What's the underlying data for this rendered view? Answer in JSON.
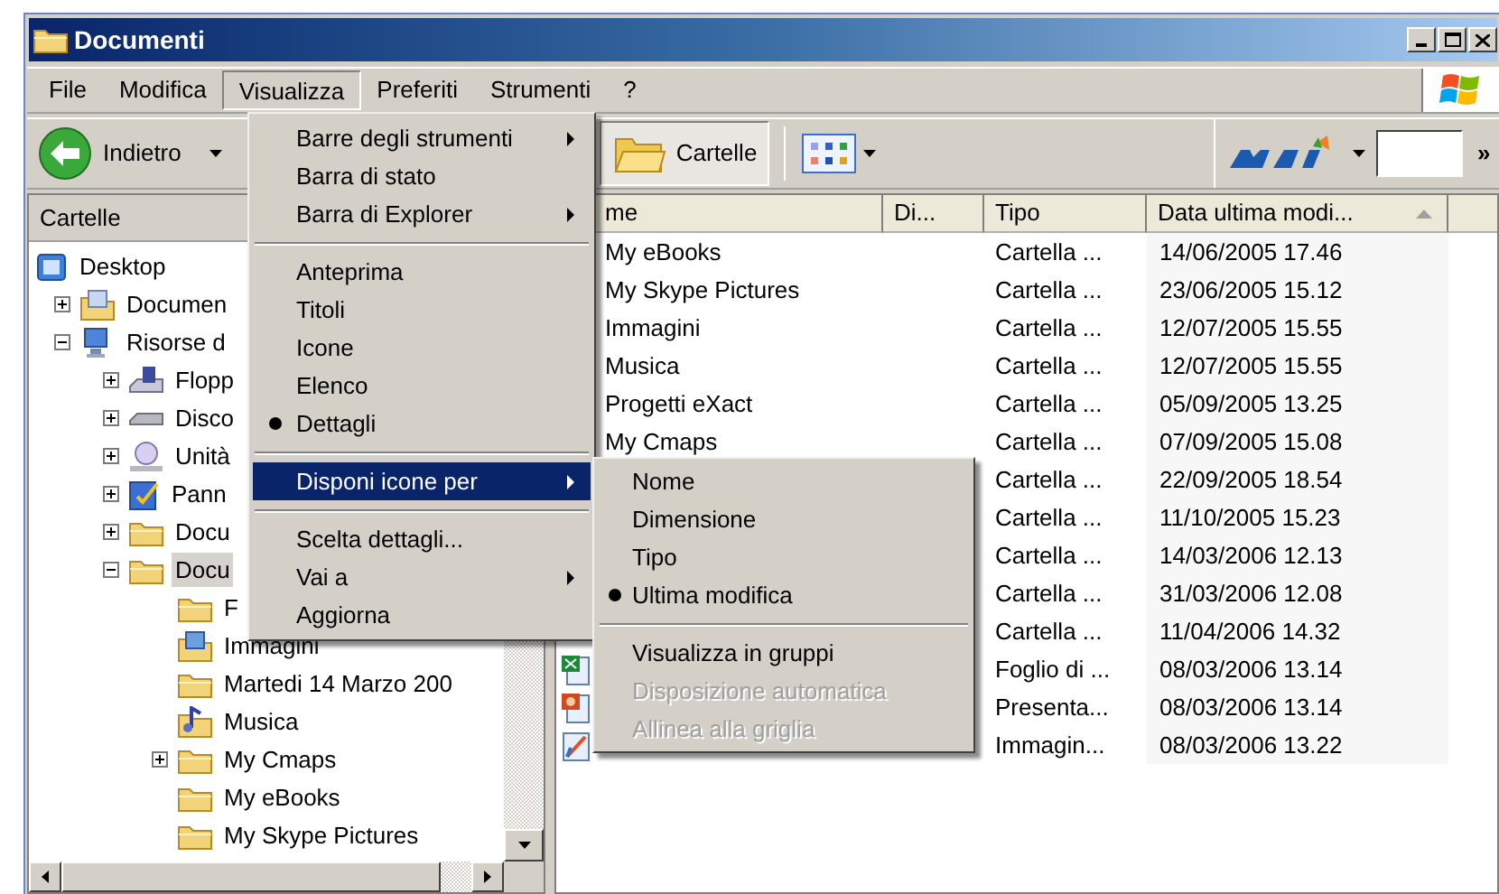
{
  "window": {
    "title": "Documenti"
  },
  "menu_bar": [
    {
      "label": "File",
      "selected": false
    },
    {
      "label": "Modifica",
      "selected": false
    },
    {
      "label": "Visualizza",
      "selected": true
    },
    {
      "label": "Preferiti",
      "selected": false
    },
    {
      "label": "Strumenti",
      "selected": false
    },
    {
      "label": "?",
      "selected": false
    }
  ],
  "toolbar": {
    "back": {
      "label": "Indietro"
    },
    "folders": {
      "label": "Cartelle",
      "pressed": true
    },
    "more": "»"
  },
  "folder_pane": {
    "title": "Cartelle",
    "tree": [
      {
        "label": "Desktop",
        "kind": "desktop",
        "has_toggle": false,
        "selected": false,
        "children": [
          {
            "label": "Documen",
            "kind": "documents",
            "has_toggle": true,
            "expanded": false,
            "selected": false
          },
          {
            "label": "Risorse d",
            "kind": "computer",
            "has_toggle": true,
            "expanded": true,
            "selected": false,
            "children": [
              {
                "label": "Flopp",
                "kind": "floppy",
                "has_toggle": true,
                "expanded": false,
                "selected": false
              },
              {
                "label": "Disco",
                "kind": "drive",
                "has_toggle": true,
                "expanded": false,
                "selected": false
              },
              {
                "label": "Unità",
                "kind": "cd",
                "has_toggle": true,
                "expanded": false,
                "selected": false
              },
              {
                "label": "Pann",
                "kind": "panel",
                "has_toggle": true,
                "expanded": false,
                "selected": false
              },
              {
                "label": "Docu",
                "kind": "folder",
                "has_toggle": true,
                "expanded": false,
                "selected": false
              },
              {
                "label": "Docu",
                "kind": "folder",
                "has_toggle": true,
                "expanded": true,
                "selected": true,
                "children": [
                  {
                    "label": "F",
                    "kind": "folder",
                    "has_toggle": false,
                    "selected": false
                  },
                  {
                    "label": "Immagini",
                    "kind": "pictures",
                    "has_toggle": false,
                    "selected": false
                  },
                  {
                    "label": "Martedi 14 Marzo 200",
                    "kind": "folder",
                    "has_toggle": false,
                    "selected": false
                  },
                  {
                    "label": "Musica",
                    "kind": "music",
                    "has_toggle": false,
                    "selected": false
                  },
                  {
                    "label": "My Cmaps",
                    "kind": "folder",
                    "has_toggle": true,
                    "expanded": false,
                    "selected": false
                  },
                  {
                    "label": "My eBooks",
                    "kind": "folder",
                    "has_toggle": false,
                    "selected": false
                  },
                  {
                    "label": "My Skype Pictures",
                    "kind": "folder",
                    "has_toggle": false,
                    "selected": false
                  }
                ]
              }
            ]
          }
        ]
      }
    ]
  },
  "file_list": {
    "columns": [
      {
        "label": "me",
        "sorted": false
      },
      {
        "label": "Di...",
        "sorted": false
      },
      {
        "label": "Tipo",
        "sorted": false
      },
      {
        "label": "Data ultima modi...",
        "sorted": true
      }
    ],
    "rows": [
      {
        "kind": "hidden",
        "name": "My eBooks",
        "type": "Cartella ...",
        "modified": "14/06/2005 17.46"
      },
      {
        "kind": "hidden",
        "name": "My Skype Pictures",
        "type": "Cartella ...",
        "modified": "23/06/2005 15.12"
      },
      {
        "kind": "hidden",
        "name": "Immagini",
        "type": "Cartella ...",
        "modified": "12/07/2005 15.55"
      },
      {
        "kind": "hidden",
        "name": "Musica",
        "type": "Cartella ...",
        "modified": "12/07/2005 15.55"
      },
      {
        "kind": "hidden",
        "name": "Progetti eXact",
        "type": "Cartella ...",
        "modified": "05/09/2005 13.25"
      },
      {
        "kind": "hidden",
        "name": "My Cmaps",
        "type": "Cartella ...",
        "modified": "07/09/2005 15.08"
      },
      {
        "kind": "hidden",
        "type": "Cartella ...",
        "modified": "22/09/2005 18.54"
      },
      {
        "kind": "hidden",
        "type": "Cartella ...",
        "modified": "11/10/2005 15.23"
      },
      {
        "kind": "hidden",
        "type": "Cartella ...",
        "modified": "14/03/2006 12.13"
      },
      {
        "kind": "hidden",
        "type": "Cartella ...",
        "modified": "31/03/2006 12.08"
      },
      {
        "kind": "hidden",
        "type": "Cartella ...",
        "modified": "11/04/2006 14.32"
      },
      {
        "kind": "spreadsheet",
        "type": "Foglio di ...",
        "modified": "08/03/2006 13.14"
      },
      {
        "kind": "presentation",
        "type": "Presenta...",
        "modified": "08/03/2006 13.14"
      },
      {
        "kind": "image",
        "type": "Immagin...",
        "modified": "08/03/2006 13.22"
      }
    ]
  },
  "view_menu": {
    "items": [
      {
        "kind": "item",
        "label": "Barre degli strumenti",
        "submenu": true,
        "checked": false,
        "selected": false
      },
      {
        "kind": "item",
        "label": "Barra di stato",
        "submenu": false,
        "checked": false,
        "selected": false
      },
      {
        "kind": "item",
        "label": "Barra di Explorer",
        "submenu": true,
        "checked": false,
        "selected": false
      },
      {
        "kind": "separator"
      },
      {
        "kind": "item",
        "label": "Anteprima",
        "submenu": false,
        "checked": false,
        "selected": false
      },
      {
        "kind": "item",
        "label": "Titoli",
        "submenu": false,
        "checked": false,
        "selected": false
      },
      {
        "kind": "item",
        "label": "Icone",
        "submenu": false,
        "checked": false,
        "selected": false
      },
      {
        "kind": "item",
        "label": "Elenco",
        "submenu": false,
        "checked": false,
        "selected": false
      },
      {
        "kind": "item",
        "label": "Dettagli",
        "submenu": false,
        "checked": true,
        "selected": false
      },
      {
        "kind": "separator"
      },
      {
        "kind": "item",
        "label": "Disponi icone per",
        "submenu": true,
        "checked": false,
        "selected": true
      },
      {
        "kind": "separator"
      },
      {
        "kind": "item",
        "label": "Scelta dettagli...",
        "submenu": false,
        "checked": false,
        "selected": false
      },
      {
        "kind": "item",
        "label": "Vai a",
        "submenu": true,
        "checked": false,
        "selected": false
      },
      {
        "kind": "item",
        "label": "Aggiorna",
        "submenu": false,
        "checked": false,
        "selected": false
      }
    ]
  },
  "arrange_submenu": {
    "items": [
      {
        "kind": "item",
        "label": "Nome",
        "checked": false,
        "disabled": false
      },
      {
        "kind": "item",
        "label": "Dimensione",
        "checked": false,
        "disabled": false
      },
      {
        "kind": "item",
        "label": "Tipo",
        "checked": false,
        "disabled": false
      },
      {
        "kind": "item",
        "label": "Ultima modifica",
        "checked": true,
        "disabled": false
      },
      {
        "kind": "separator"
      },
      {
        "kind": "item",
        "label": "Visualizza in gruppi",
        "checked": false,
        "disabled": false
      },
      {
        "kind": "item",
        "label": "Disposizione automatica",
        "checked": false,
        "disabled": true
      },
      {
        "kind": "item",
        "label": "Allinea alla griglia",
        "checked": false,
        "disabled": true
      }
    ]
  }
}
